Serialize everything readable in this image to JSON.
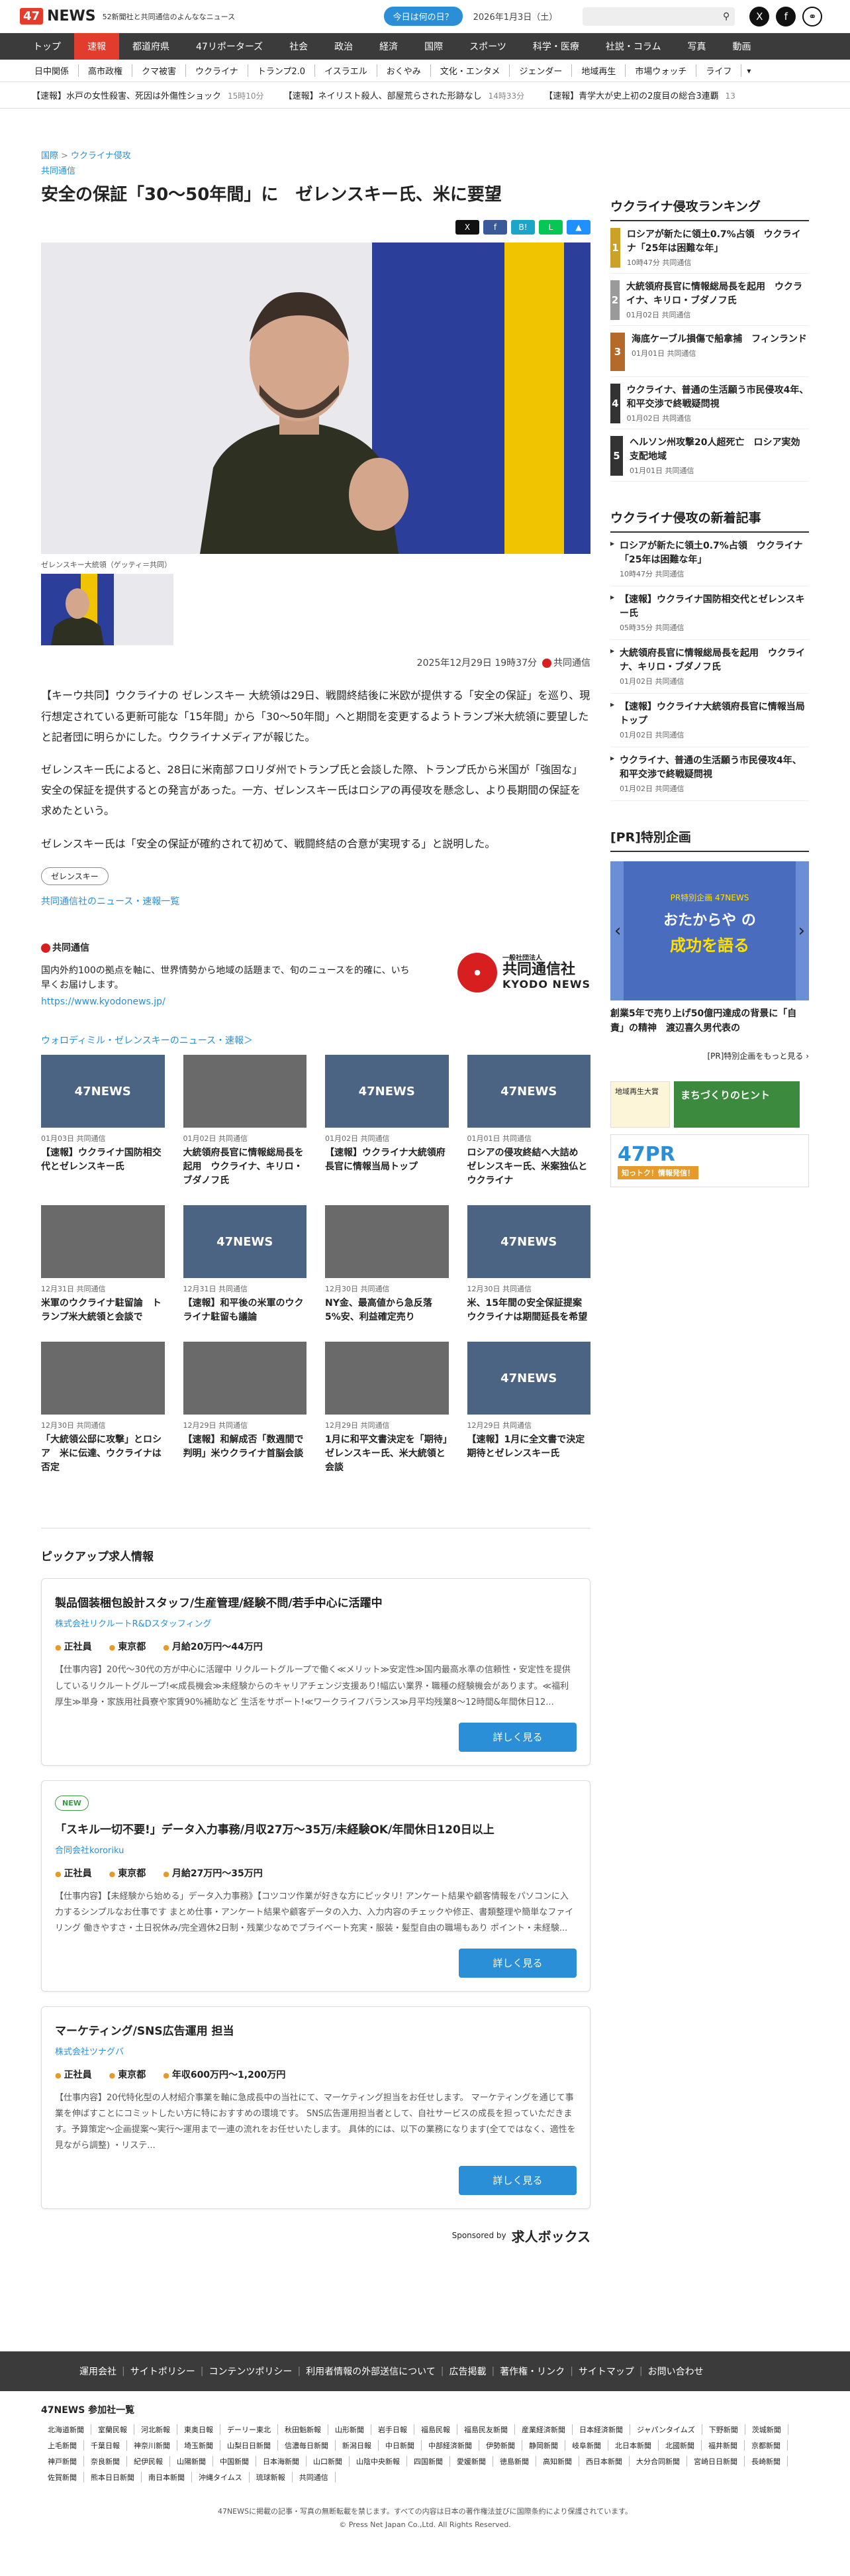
{
  "header": {
    "logo_box": "47",
    "logo_text": "NEWS",
    "tagline": "52新聞社と共同通信のよんななニュース",
    "today_button": "今日は何の日？",
    "date": "2026年1月3日（土）"
  },
  "nav_main": [
    "トップ",
    "速報",
    "都道府県",
    "47リポーターズ",
    "社会",
    "政治",
    "経済",
    "国際",
    "スポーツ",
    "科学・医療",
    "社説・コラム",
    "写真",
    "動画"
  ],
  "nav_sub": [
    "日中関係",
    "高市政権",
    "クマ被害",
    "ウクライナ",
    "トランプ2.0",
    "イスラエル",
    "おくやみ",
    "文化・エンタメ",
    "ジェンダー",
    "地域再生",
    "市場ウォッチ",
    "ライフ"
  ],
  "ticker": [
    {
      "text": "【速報】水戸の女性殺害、死因は外傷性ショック",
      "time": "15時10分"
    },
    {
      "text": "【速報】ネイリスト殺人、部屋荒らされた形跡なし",
      "time": "14時33分"
    },
    {
      "text": "【速報】青学大が史上初の2度目の総合3連覇",
      "time": "13"
    }
  ],
  "article": {
    "crumb_1": "国際",
    "crumb_2": "ウクライナ侵攻",
    "sub_label": "共同通信",
    "title": "安全の保証「30～50年間」に　ゼレンスキー氏、米に要望",
    "caption": "ゼレンスキー大統領（ゲッティ＝共同）",
    "date": "2025年12月29日 19時37分",
    "source": "共同通信",
    "paragraphs": [
      "【キーウ共同】ウクライナの ゼレンスキー 大統領は29日、戦闘終結後に米欧が提供する「安全の保証」を巡り、現行想定されている更新可能な「15年間」から「30～50年間」へと期間を変更するようトランプ米大統領に要望したと記者団に明らかにした。ウクライナメディアが報じた。",
      "ゼレンスキー氏によると、28日に米南部フロリダ州でトランプ氏と会談した際、トランプ氏から米国が「強固な」安全の保証を提供するとの発言があった。一方、ゼレンスキー氏はロシアの再侵攻を懸念し、より長期間の保証を求めたという。",
      "ゼレンスキー氏は「安全の保証が確約されて初めて、戦闘終結の合意が実現する」と説明した。"
    ],
    "tag": "ゼレンスキー",
    "news_link": "共同通信社のニュース・速報一覧"
  },
  "kyodo": {
    "name": "共同通信",
    "desc": "国内外約100の拠点を軸に、世界情勢から地域の話題まで、旬のニュースを的確に、いち早くお届けします。",
    "url": "https://www.kyodonews.jp/",
    "logo_circle": "一般社団法人",
    "logo_text": "共同通信社",
    "logo_en": "KYODO NEWS"
  },
  "related": {
    "heading": "ウォロディミル・ゼレンスキーのニュース・速報＞",
    "items": [
      {
        "meta": "01月03日 共同通信",
        "title": "【速報】ウクライナ国防相交代とゼレンスキー氏",
        "img": "47NEWS"
      },
      {
        "meta": "01月02日 共同通信",
        "title": "大統領府長官に情報総局長を起用　ウクライナ、キリロ・ブダノフ氏",
        "img": ""
      },
      {
        "meta": "01月02日 共同通信",
        "title": "【速報】ウクライナ大統領府長官に情報当局トップ",
        "img": "47NEWS"
      },
      {
        "meta": "01月01日 共同通信",
        "title": "ロシアの侵攻終結へ大詰め　ゼレンスキー氏、米案独仏とウクライナ",
        "img": "47NEWS"
      },
      {
        "meta": "12月31日 共同通信",
        "title": "米軍のウクライナ駐留論　トランプ米大統領と会談で",
        "img": ""
      },
      {
        "meta": "12月31日 共同通信",
        "title": "【速報】和平後の米軍のウクライナ駐留も議論",
        "img": "47NEWS"
      },
      {
        "meta": "12月30日 共同通信",
        "title": "NY金、最高値から急反落　5%安、利益確定売り",
        "img": ""
      },
      {
        "meta": "12月30日 共同通信",
        "title": "米、15年間の安全保証提案　ウクライナは期間延長を希望",
        "img": "47NEWS"
      },
      {
        "meta": "12月30日 共同通信",
        "title": "「大統領公邸に攻撃」とロシア　米に伝達、ウクライナは否定",
        "img": ""
      },
      {
        "meta": "12月29日 共同通信",
        "title": "【速報】和解成否「数週間で判明」米ウクライナ首脳会談",
        "img": ""
      },
      {
        "meta": "12月29日 共同通信",
        "title": "1月に和平文書決定を「期待」ゼレンスキー氏、米大統領と会談",
        "img": ""
      },
      {
        "meta": "12月29日 共同通信",
        "title": "【速報】1月に全文書で決定期待とゼレンスキー氏",
        "img": "47NEWS"
      }
    ]
  },
  "jobs": {
    "heading": "ピックアップ求人情報",
    "items": [
      {
        "is_new": false,
        "new_label": "",
        "title": "製品個装梱包設計スタッフ/生産管理/経験不問/若手中心に活躍中",
        "company": "株式会社リクルートR&Dスタッフィング",
        "type": "正社員",
        "place": "東京都",
        "salary": "月給20万円～44万円",
        "desc": "【仕事内容】20代〜30代の方が中心に活躍中 リクルートグループで働く≪メリット≫安定性≫国内最高水準の信頼性・安定性を提供しているリクルートグループ!≪成長機会≫未経験からのキャリアチェンジ支援あり!幅広い業界・職種の経験機会があります。≪福利厚生≫単身・家族用社員寮や家賃90%補助など 生活をサポート!≪ワークライフバランス≫月平均残業8〜12時間&年間休日12...",
        "button": "詳しく見る"
      },
      {
        "is_new": true,
        "new_label": "NEW",
        "title": "「スキル一切不要!」データ入力事務/月収27万～35万/未経験OK/年間休日120日以上",
        "company": "合同会社kororiku",
        "type": "正社員",
        "place": "東京都",
        "salary": "月給27万円～35万円",
        "desc": "【仕事内容】【未経験から始める」データ入力事務》【コツコツ作業が好きな方にピッタリ! アンケート結果や顧客情報をパソコンに入力するシンプルなお仕事です まとめ仕事・アンケート結果や顧客データの入力、入力内容のチェックや修正、書類整理や簡単なファイリング 働きやすさ・土日祝休み/完全週休2日制・残業少なめでプライベート充実・服装・髪型自由の職場もあり ポイント・未経験...",
        "button": "詳しく見る"
      },
      {
        "is_new": false,
        "new_label": "",
        "title": "マーケティング/SNS広告運用 担当",
        "company": "株式会社ツナグバ",
        "type": "正社員",
        "place": "東京都",
        "salary": "年収600万円～1,200万円",
        "desc": "【仕事内容】20代特化型の人材紹介事業を軸に急成長中の当社にて、マーケティング担当をお任せします。 マーケティングを通じて事業を伸ばすことにコミットしたい方に特におすすめの環境です。 SNS広告運用担当者として、自社サービスの成長を担っていただきます。予算策定〜企画提案〜実行〜運用まで一連の流れをお任せいたします。 具体的には、以下の業務になります(全てではなく、適性を見ながら調整) ・リステ...",
        "button": "詳しく見る"
      }
    ],
    "sponsored": "Sponsored by",
    "sponsor_name": "求人ボックス"
  },
  "sidebar": {
    "ranking_heading": "ウクライナ侵攻ランキング",
    "ranking": [
      {
        "num": "1",
        "title": "ロシアが新たに領土0.7%占領　ウクライナ「25年は困難な年」",
        "meta": "10時47分 共同通信",
        "color": "#c9a227"
      },
      {
        "num": "2",
        "title": "大統領府長官に情報総局長を起用　ウクライナ、キリロ・ブダノフ氏",
        "meta": "01月02日 共同通信",
        "color": "#9a9a9a"
      },
      {
        "num": "3",
        "title": "海底ケーブル損傷で船拿捕　フィンランド",
        "meta": "01月01日 共同通信",
        "color": "#b36a2a"
      },
      {
        "num": "4",
        "title": "ウクライナ、普通の生活願う市民侵攻4年、和平交渉で終戦疑問視",
        "meta": "01月02日 共同通信",
        "color": "#333333"
      },
      {
        "num": "5",
        "title": "ヘルソン州攻撃20人超死亡　ロシア実効支配地域",
        "meta": "01月01日 共同通信",
        "color": "#333333"
      }
    ],
    "latest_heading": "ウクライナ侵攻の新着記事",
    "latest": [
      {
        "title": "ロシアが新たに領土0.7%占領　ウクライナ「25年は困難な年」",
        "meta": "10時47分 共同通信"
      },
      {
        "title": "【速報】ウクライナ国防相交代とゼレンスキー氏",
        "meta": "05時35分 共同通信"
      },
      {
        "title": "大統領府長官に情報総局長を起用　ウクライナ、キリロ・ブダノフ氏",
        "meta": "01月02日 共同通信"
      },
      {
        "title": "【速報】ウクライナ大統領府長官に情報当局トップ",
        "meta": "01月02日 共同通信"
      },
      {
        "title": "ウクライナ、普通の生活願う市民侵攻4年、和平交渉で終戦疑問視",
        "meta": "01月02日 共同通信"
      }
    ],
    "pr_heading": "[PR]特別企画",
    "pr_banner_1": "PR特別企画 47NEWS",
    "pr_banner_2": "おたからや の",
    "pr_banner_3": "成功を語る",
    "pr_title": "創業5年で売り上げ50億円達成の背景に「自責」の精神　渡辺喜久男代表の",
    "pr_more": "[PR]特別企画をもっと見る ›",
    "ad1_a": "地域再生大賞",
    "ad1_b": "まちづくりのヒント",
    "ad2_a": "47PR",
    "ad2_b": "知っトク！情報発信！"
  },
  "footer": {
    "links": [
      "運用会社",
      "サイトポリシー",
      "コンテンツポリシー",
      "利用者情報の外部送信について",
      "広告掲載",
      "著作権・リンク",
      "サイトマップ",
      "お問い合わせ"
    ],
    "sites_heading": "47NEWS 参加社一覧",
    "sites": [
      "北海道新聞",
      "室蘭民報",
      "河北新報",
      "東奥日報",
      "デーリー東北",
      "秋田魁新報",
      "山形新聞",
      "岩手日報",
      "福島民報",
      "福島民友新聞",
      "産業経済新聞",
      "日本経済新聞",
      "ジャパンタイムズ",
      "下野新聞",
      "茨城新聞",
      "上毛新聞",
      "千葉日報",
      "神奈川新聞",
      "埼玉新聞",
      "山梨日日新聞",
      "信濃毎日新聞",
      "新潟日報",
      "中日新聞",
      "中部経済新聞",
      "伊勢新聞",
      "静岡新聞",
      "岐阜新聞",
      "北日本新聞",
      "北國新聞",
      "福井新聞",
      "京都新聞",
      "神戸新聞",
      "奈良新聞",
      "紀伊民報",
      "山陽新聞",
      "中国新聞",
      "日本海新聞",
      "山口新聞",
      "山陰中央新報",
      "四国新聞",
      "愛媛新聞",
      "徳島新聞",
      "高知新聞",
      "西日本新聞",
      "大分合同新聞",
      "宮崎日日新聞",
      "長崎新聞",
      "佐賀新聞",
      "熊本日日新聞",
      "南日本新聞",
      "沖縄タイムス",
      "琉球新報",
      "共同通信"
    ],
    "copy_1": "47NEWSに掲載の記事・写真の無断転載を禁じます。すべての内容は日本の著作権法並びに国際条約により保護されています。",
    "copy_2": "© Press Net Japan Co.,Ltd. All Rights Reserved."
  },
  "colors": {
    "accent": "#e23c2c",
    "link": "#2a8fd6",
    "nav": "#3b3b3b"
  }
}
